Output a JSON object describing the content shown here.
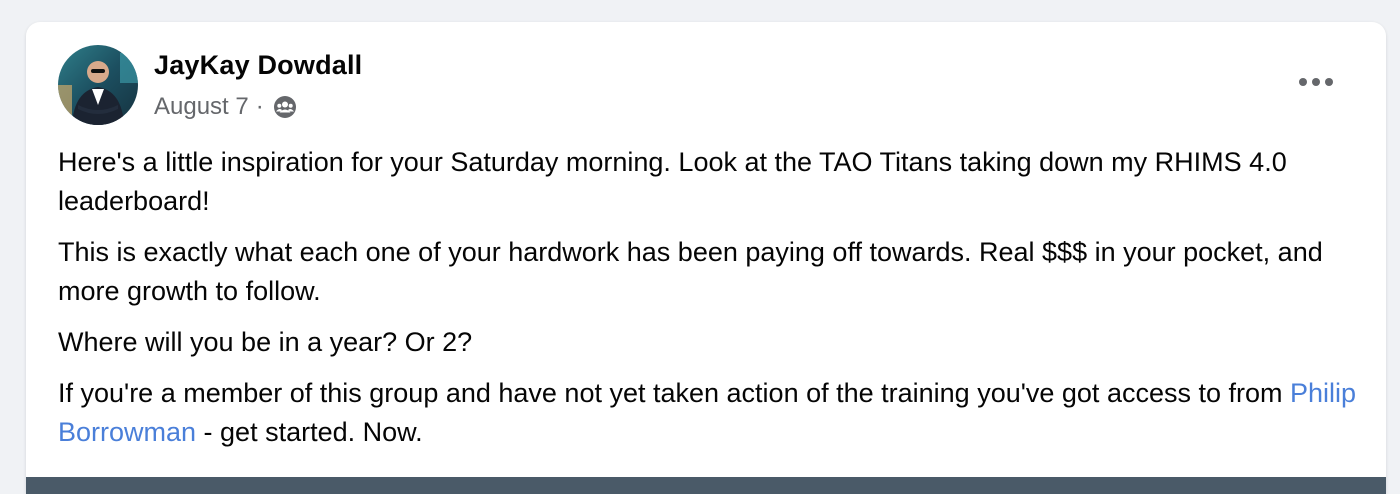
{
  "post": {
    "author": "JayKay Dowdall",
    "date": "August 7",
    "separator": "·",
    "audience_icon": "group-audience-icon",
    "more_icon": "more-options-icon",
    "paragraphs": {
      "p1": "Here's a little inspiration for your Saturday morning. Look at the TAO Titans taking down my RHIMS 4.0 leaderboard!",
      "p2": "This is exactly what each one of your hardwork has been paying off towards. Real $$$ in your pocket, and more growth to follow.",
      "p3": "Where will you be in a year? Or 2?",
      "p4_before": "If you're a member of this group and have not yet taken action of the training you've got access to from ",
      "p4_mention": "Philip Borrowman",
      "p4_after": " - get started. Now."
    }
  },
  "colors": {
    "page_background": "#f0f2f5",
    "card_background": "#ffffff",
    "primary_text": "#050505",
    "secondary_text": "#65676b",
    "mention_link": "#4a7fd9",
    "media_strip": "#4a5a68"
  }
}
